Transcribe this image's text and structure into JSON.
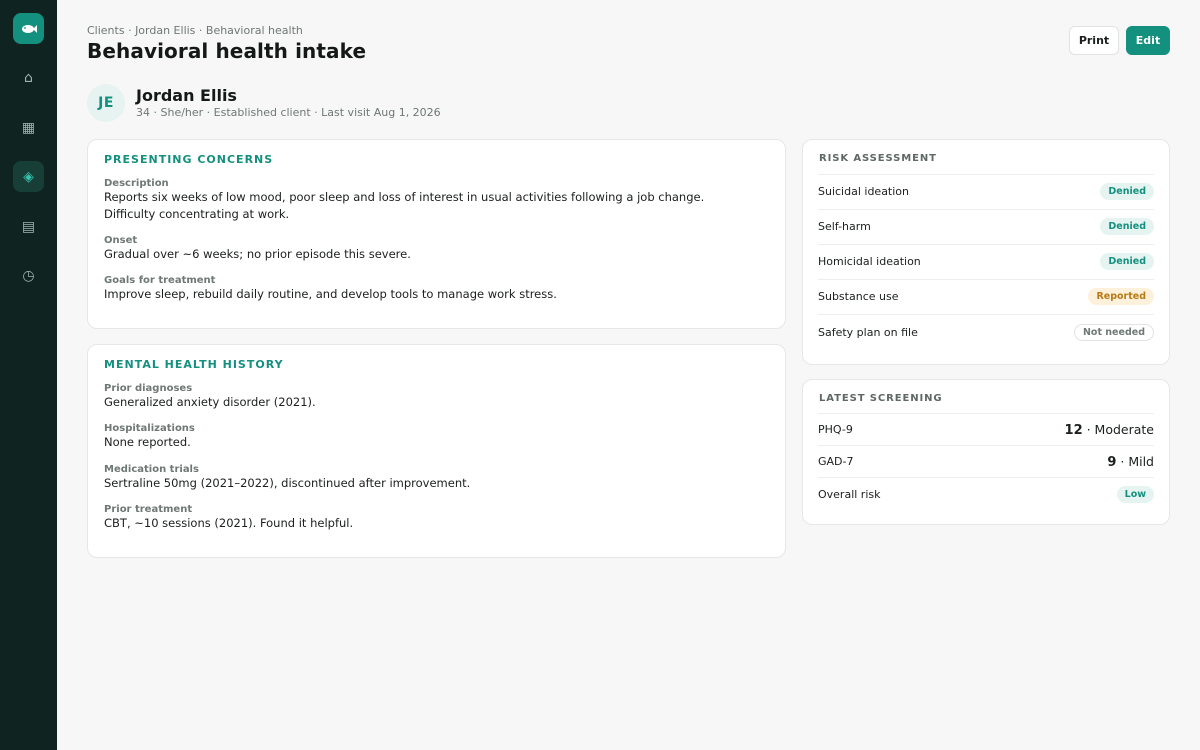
{
  "sidebar": {
    "logo_icon": "fish-icon",
    "items": [
      {
        "icon": "home-icon",
        "glyph": "⌂",
        "active": false
      },
      {
        "icon": "calendar-icon",
        "glyph": "▦",
        "active": false
      },
      {
        "icon": "diamond-icon",
        "glyph": "◈",
        "active": true
      },
      {
        "icon": "document-icon",
        "glyph": "▤",
        "active": false
      },
      {
        "icon": "clock-icon",
        "glyph": "◷",
        "active": false
      }
    ]
  },
  "header": {
    "breadcrumb": "Clients · Jordan Ellis · Behavioral health",
    "title": "Behavioral health intake",
    "print_label": "Print",
    "edit_label": "Edit"
  },
  "client": {
    "initials": "JE",
    "name": "Jordan Ellis",
    "meta": "34 · She/her · Established client · Last visit Aug 1, 2026"
  },
  "presenting": {
    "title": "PRESENTING CONCERNS",
    "fields": [
      {
        "label": "Description",
        "value": "Reports six weeks of low mood, poor sleep and loss of interest in usual activities following a job change. Difficulty concentrating at work."
      },
      {
        "label": "Onset",
        "value": "Gradual over ~6 weeks; no prior episode this severe."
      },
      {
        "label": "Goals for treatment",
        "value": "Improve sleep, rebuild daily routine, and develop tools to manage work stress."
      }
    ]
  },
  "history": {
    "title": "MENTAL HEALTH HISTORY",
    "fields": [
      {
        "label": "Prior diagnoses",
        "value": "Generalized anxiety disorder (2021)."
      },
      {
        "label": "Hospitalizations",
        "value": "None reported."
      },
      {
        "label": "Medication trials",
        "value": "Sertraline 50mg (2021–2022), discontinued after improvement."
      },
      {
        "label": "Prior treatment",
        "value": "CBT, ~10 sessions (2021). Found it helpful."
      }
    ]
  },
  "risk": {
    "title": "RISK ASSESSMENT",
    "rows": [
      {
        "label": "Suicidal ideation",
        "status": "Denied",
        "tone": "green"
      },
      {
        "label": "Self-harm",
        "status": "Denied",
        "tone": "green"
      },
      {
        "label": "Homicidal ideation",
        "status": "Denied",
        "tone": "green"
      },
      {
        "label": "Substance use",
        "status": "Reported",
        "tone": "amber"
      },
      {
        "label": "Safety plan on file",
        "status": "Not needed",
        "tone": "gray"
      }
    ]
  },
  "screening": {
    "title": "LATEST SCREENING",
    "rows": [
      {
        "label": "PHQ-9",
        "score": "12",
        "severity": "Moderate"
      },
      {
        "label": "GAD-7",
        "score": "9",
        "severity": "Mild"
      }
    ],
    "overall": {
      "label": "Overall risk",
      "status": "Low",
      "tone": "green"
    }
  },
  "colors": {
    "accent": "#14907f",
    "sidebar_bg": "#0f2420",
    "badge_amber": "#b97a16"
  }
}
